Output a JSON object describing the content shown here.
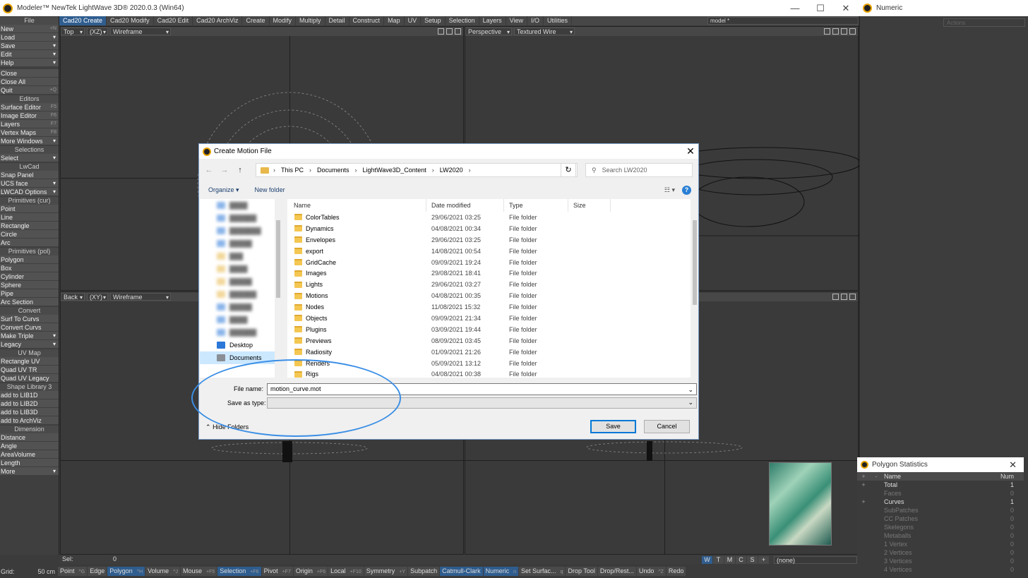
{
  "app": {
    "title": "Modeler™ NewTek LightWave 3D® 2020.0.3 (Win64)",
    "min": "—",
    "max": "☐",
    "close": "✕"
  },
  "numeric": {
    "title": "Numeric",
    "actions": "Actions"
  },
  "tabs": [
    "Cad20 Create",
    "Cad20 Modify",
    "Cad20 Edit",
    "Cad20 ArchViz",
    "Create",
    "Modify",
    "Multiply",
    "Detail",
    "Construct",
    "Map",
    "UV",
    "Setup",
    "Selection",
    "Layers",
    "View",
    "I/O",
    "Utilities"
  ],
  "model_select": "model *",
  "sidebar": {
    "sections": [
      {
        "head": "File",
        "items": [
          {
            "l": "New",
            "k": "+N"
          },
          {
            "l": "Load",
            "dd": "▾"
          },
          {
            "l": "Save",
            "dd": "▾"
          },
          {
            "l": "Edit",
            "dd": "▾"
          },
          {
            "l": "Help",
            "dd": "▾"
          }
        ]
      },
      {
        "head": "",
        "items": [
          {
            "l": "Close"
          },
          {
            "l": "Close All"
          },
          {
            "l": "Quit",
            "k": "+Q"
          }
        ]
      },
      {
        "head": "Editors",
        "items": [
          {
            "l": "Surface Editor",
            "k": "F5"
          },
          {
            "l": "Image Editor",
            "k": "F6"
          },
          {
            "l": "Layers",
            "k": "F7"
          },
          {
            "l": "Vertex Maps",
            "k": "F8"
          },
          {
            "l": "More Windows",
            "dd": "▾"
          }
        ]
      },
      {
        "head": "Selections",
        "items": [
          {
            "l": "Select",
            "dd": "▾"
          }
        ]
      },
      {
        "head": "LwCad",
        "items": [
          {
            "l": "Snap Panel"
          },
          {
            "l": "UCS face",
            "dd": "▾"
          },
          {
            "l": "LWCAD Options",
            "dd": "▾"
          }
        ]
      },
      {
        "head": "Primitives (cur)",
        "items": [
          {
            "l": "Point"
          },
          {
            "l": "Line"
          },
          {
            "l": "Rectangle"
          },
          {
            "l": "Circle"
          },
          {
            "l": "Arc"
          }
        ]
      },
      {
        "head": "Primitives (pol)",
        "items": [
          {
            "l": "Polygon"
          },
          {
            "l": "Box"
          },
          {
            "l": "Cylinder"
          },
          {
            "l": "Sphere"
          },
          {
            "l": "Pipe"
          },
          {
            "l": "Arc Section"
          }
        ]
      },
      {
        "head": "Convert",
        "items": [
          {
            "l": "Surf To Curvs"
          },
          {
            "l": "Convert Curvs"
          },
          {
            "l": "Make Triple",
            "dd": "▾"
          },
          {
            "l": "Legacy",
            "dd": "▾"
          }
        ]
      },
      {
        "head": "UV Map",
        "items": [
          {
            "l": "Rectangle UV"
          },
          {
            "l": "Quad UV TR"
          },
          {
            "l": "Quad UV Legacy"
          }
        ]
      },
      {
        "head": "Shape Library 3",
        "items": [
          {
            "l": "add to LIB1D"
          },
          {
            "l": "add to LIB2D"
          },
          {
            "l": "add to LIB3D"
          },
          {
            "l": "add to ArchViz"
          }
        ]
      },
      {
        "head": "Dimension",
        "items": [
          {
            "l": "Distance"
          },
          {
            "l": "Angle"
          },
          {
            "l": "AreaVolume"
          },
          {
            "l": "Length"
          },
          {
            "l": "More",
            "dd": "▾"
          }
        ]
      }
    ]
  },
  "viewports": {
    "tl": {
      "view": "Top",
      "axes": "(XZ)",
      "mode": "Wireframe"
    },
    "tr": {
      "view": "Perspective",
      "mode": "Textured Wire"
    },
    "bl": {
      "view": "Back",
      "axes": "(XY)",
      "mode": "Wireframe"
    }
  },
  "status": {
    "sel_label": "Sel:",
    "sel_value": "0",
    "grid_label": "Grid:",
    "grid_value": "50 cm"
  },
  "bottom_buttons": [
    {
      "l": "Point",
      "k": "^G"
    },
    {
      "l": "Edge",
      "k": ""
    },
    {
      "l": "Polygon",
      "k": "^H",
      "on": true
    },
    {
      "l": "Volume",
      "k": "^J"
    },
    {
      "l": "Mouse",
      "k": "+F5"
    },
    {
      "l": "Selection",
      "k": "+F6",
      "on": true
    },
    {
      "l": "Pivot",
      "k": "+F7"
    },
    {
      "l": "Origin",
      "k": "+F6"
    },
    {
      "l": "Local",
      "k": "+F10"
    },
    {
      "l": "Symmetry",
      "k": "+Y"
    },
    {
      "l": "Subpatch",
      "k": ""
    },
    {
      "l": "Catmull-Clark",
      "k": "",
      "on": true
    },
    {
      "l": "Numeric",
      "k": "n",
      "on": true
    },
    {
      "l": "Set Surfac...",
      "k": "q"
    },
    {
      "l": "Drop Tool",
      "k": ""
    },
    {
      "l": "Drop/Rest...",
      "k": ""
    },
    {
      "l": "Undo",
      "k": "^Z"
    },
    {
      "l": "Redo",
      "k": ""
    }
  ],
  "wtc": [
    "W",
    "T",
    "M",
    "C",
    "S",
    "+"
  ],
  "surface_select": "(none)",
  "poly_stats": {
    "title": "Polygon Statistics",
    "col_name": "Name",
    "col_num": "Num",
    "rows": [
      {
        "n": "Total",
        "v": "1",
        "dim": false
      },
      {
        "n": "Faces",
        "v": "0",
        "dim": true
      },
      {
        "n": "Curves",
        "v": "1",
        "dim": false
      },
      {
        "n": "SubPatches",
        "v": "0",
        "dim": true
      },
      {
        "n": "CC Patches",
        "v": "0",
        "dim": true
      },
      {
        "n": "Skelegons",
        "v": "0",
        "dim": true
      },
      {
        "n": "Metaballs",
        "v": "0",
        "dim": true
      },
      {
        "n": "1 Vertex",
        "v": "0",
        "dim": true
      },
      {
        "n": "2 Vertices",
        "v": "0",
        "dim": true
      },
      {
        "n": "3 Vertices",
        "v": "0",
        "dim": true
      },
      {
        "n": "4 Vertices",
        "v": "0",
        "dim": true
      }
    ]
  },
  "dialog": {
    "title": "Create Motion File",
    "path": [
      "This PC",
      "Documents",
      "LightWave3D_Content",
      "LW2020"
    ],
    "search_placeholder": "Search LW2020",
    "organize": "Organize ▾",
    "new_folder": "New folder",
    "cols": {
      "name": "Name",
      "date": "Date modified",
      "type": "Type",
      "size": "Size"
    },
    "nav_items": [
      {
        "l": "Desktop",
        "c": "#2b78d8"
      },
      {
        "l": "Documents",
        "c": "#8a8f96"
      }
    ],
    "files": [
      {
        "n": "ColorTables",
        "d": "29/06/2021 03:25",
        "t": "File folder"
      },
      {
        "n": "Dynamics",
        "d": "04/08/2021 00:34",
        "t": "File folder"
      },
      {
        "n": "Envelopes",
        "d": "29/06/2021 03:25",
        "t": "File folder"
      },
      {
        "n": "export",
        "d": "14/08/2021 00:54",
        "t": "File folder"
      },
      {
        "n": "GridCache",
        "d": "09/09/2021 19:24",
        "t": "File folder"
      },
      {
        "n": "Images",
        "d": "29/08/2021 18:41",
        "t": "File folder"
      },
      {
        "n": "Lights",
        "d": "29/06/2021 03:27",
        "t": "File folder"
      },
      {
        "n": "Motions",
        "d": "04/08/2021 00:35",
        "t": "File folder"
      },
      {
        "n": "Nodes",
        "d": "11/08/2021 15:32",
        "t": "File folder"
      },
      {
        "n": "Objects",
        "d": "09/09/2021 21:34",
        "t": "File folder"
      },
      {
        "n": "Plugins",
        "d": "03/09/2021 19:44",
        "t": "File folder"
      },
      {
        "n": "Previews",
        "d": "08/09/2021 03:45",
        "t": "File folder"
      },
      {
        "n": "Radiosity",
        "d": "01/09/2021 21:26",
        "t": "File folder"
      },
      {
        "n": "Renders",
        "d": "05/09/2021 13:12",
        "t": "File folder"
      },
      {
        "n": "Rigs",
        "d": "04/08/2021 00:38",
        "t": "File folder"
      }
    ],
    "file_name_label": "File name:",
    "file_name_value": "motion_curve.mot",
    "save_type_label": "Save as type:",
    "save_type_value": "",
    "hide_folders": "Hide Folders",
    "save": "Save",
    "cancel": "Cancel"
  }
}
